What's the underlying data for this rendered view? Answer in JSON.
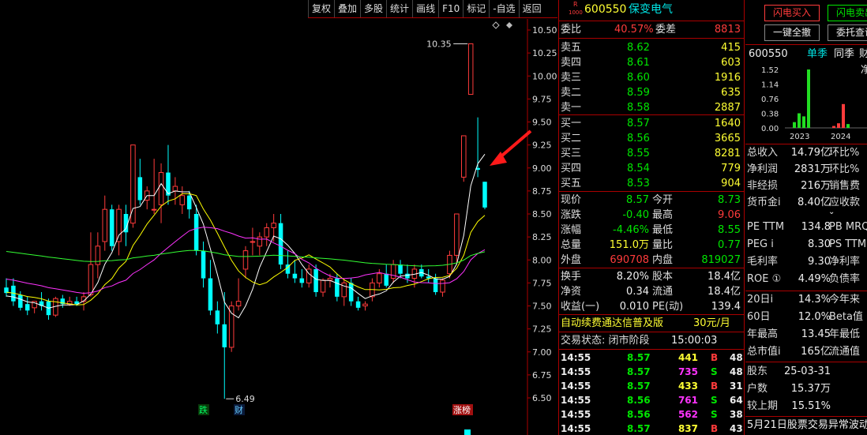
{
  "toolbar": {
    "items": [
      "复权",
      "叠加",
      "多股",
      "统计",
      "画线",
      "F10",
      "标记",
      "-自选",
      "返回"
    ]
  },
  "chart": {
    "price_axis": [
      "10.50",
      "10.25",
      "10.00",
      "9.75",
      "9.50",
      "9.25",
      "9.00",
      "8.75",
      "8.50",
      "8.25",
      "8.00",
      "7.75",
      "7.50",
      "7.25",
      "7.00",
      "6.75",
      "6.50"
    ],
    "high_label": "10.35",
    "low_label": "6.49",
    "markers": {
      "die": "跌",
      "cai": "财",
      "zhangbang": "涨榜"
    },
    "colors": {
      "up": "#ff3b3b",
      "down": "#00ffff",
      "ma5": "#ffffff",
      "ma10": "#ffff00",
      "ma20": "#ff33ff",
      "ma60": "#33ff33"
    },
    "candles": [
      {
        "o": 7.7,
        "h": 7.8,
        "l": 7.6,
        "c": 7.64
      },
      {
        "o": 7.72,
        "h": 7.8,
        "l": 7.5,
        "c": 7.55
      },
      {
        "o": 7.62,
        "h": 7.66,
        "l": 7.45,
        "c": 7.48
      },
      {
        "o": 7.52,
        "h": 7.6,
        "l": 7.4,
        "c": 7.45
      },
      {
        "o": 7.48,
        "h": 7.55,
        "l": 7.42,
        "c": 7.55
      },
      {
        "o": 7.55,
        "h": 7.65,
        "l": 7.45,
        "c": 7.5
      },
      {
        "o": 7.55,
        "h": 7.58,
        "l": 7.35,
        "c": 7.4
      },
      {
        "o": 7.4,
        "h": 7.6,
        "l": 7.38,
        "c": 7.58
      },
      {
        "o": 7.58,
        "h": 7.62,
        "l": 7.48,
        "c": 7.52
      },
      {
        "o": 7.52,
        "h": 7.6,
        "l": 7.5,
        "c": 7.55
      },
      {
        "o": 7.55,
        "h": 7.6,
        "l": 7.5,
        "c": 7.52
      },
      {
        "o": 7.55,
        "h": 7.65,
        "l": 7.45,
        "c": 7.6
      },
      {
        "o": 7.62,
        "h": 8.3,
        "l": 7.6,
        "c": 7.95
      },
      {
        "o": 7.95,
        "h": 8.3,
        "l": 7.8,
        "c": 8.15
      },
      {
        "o": 8.2,
        "h": 8.7,
        "l": 8.1,
        "c": 8.55
      },
      {
        "o": 8.55,
        "h": 8.6,
        "l": 8.1,
        "c": 8.15
      },
      {
        "o": 8.2,
        "h": 8.6,
        "l": 8.05,
        "c": 8.55
      },
      {
        "o": 8.5,
        "h": 8.6,
        "l": 8.15,
        "c": 8.3
      },
      {
        "o": 8.4,
        "h": 9.25,
        "l": 8.35,
        "c": 9.25
      },
      {
        "o": 8.9,
        "h": 9.1,
        "l": 8.6,
        "c": 8.65
      },
      {
        "o": 8.65,
        "h": 8.8,
        "l": 8.55,
        "c": 8.75
      },
      {
        "o": 8.55,
        "h": 9.1,
        "l": 8.5,
        "c": 8.55
      },
      {
        "o": 8.6,
        "h": 9.05,
        "l": 8.4,
        "c": 8.95
      },
      {
        "o": 8.95,
        "h": 9.25,
        "l": 8.6,
        "c": 8.7
      },
      {
        "o": 8.75,
        "h": 8.9,
        "l": 8.6,
        "c": 8.8
      },
      {
        "o": 8.6,
        "h": 8.8,
        "l": 8.5,
        "c": 8.7
      },
      {
        "o": 8.7,
        "h": 8.75,
        "l": 8.45,
        "c": 8.55
      },
      {
        "o": 8.5,
        "h": 8.6,
        "l": 8.05,
        "c": 8.1
      },
      {
        "o": 8.1,
        "h": 8.2,
        "l": 7.7,
        "c": 7.8
      },
      {
        "o": 7.8,
        "h": 8.0,
        "l": 7.4,
        "c": 7.45
      },
      {
        "o": 7.45,
        "h": 7.55,
        "l": 7.2,
        "c": 7.3
      },
      {
        "o": 7.3,
        "h": 7.65,
        "l": 6.49,
        "c": 7.05
      },
      {
        "o": 7.05,
        "h": 7.55,
        "l": 7.0,
        "c": 7.5
      },
      {
        "o": 7.5,
        "h": 7.8,
        "l": 7.45,
        "c": 7.55
      },
      {
        "o": 7.9,
        "h": 8.15,
        "l": 7.8,
        "c": 8.1
      },
      {
        "o": 8.2,
        "h": 8.35,
        "l": 8.05,
        "c": 8.2
      },
      {
        "o": 8.15,
        "h": 8.3,
        "l": 8.05,
        "c": 8.25
      },
      {
        "o": 8.25,
        "h": 8.4,
        "l": 8.15,
        "c": 8.35
      },
      {
        "o": 8.35,
        "h": 8.5,
        "l": 8.2,
        "c": 8.4
      },
      {
        "o": 8.4,
        "h": 8.5,
        "l": 7.9,
        "c": 7.95
      },
      {
        "o": 7.95,
        "h": 8.1,
        "l": 7.8,
        "c": 7.85
      },
      {
        "o": 7.85,
        "h": 8.0,
        "l": 7.75,
        "c": 7.8
      },
      {
        "o": 7.8,
        "h": 7.9,
        "l": 7.7,
        "c": 7.75
      },
      {
        "o": 7.75,
        "h": 7.95,
        "l": 7.7,
        "c": 7.9
      },
      {
        "o": 7.9,
        "h": 7.95,
        "l": 7.6,
        "c": 7.65
      },
      {
        "o": 7.65,
        "h": 7.8,
        "l": 7.6,
        "c": 7.78
      },
      {
        "o": 7.78,
        "h": 7.85,
        "l": 7.7,
        "c": 7.8
      },
      {
        "o": 7.8,
        "h": 7.85,
        "l": 7.55,
        "c": 7.6
      },
      {
        "o": 7.6,
        "h": 7.8,
        "l": 7.5,
        "c": 7.75
      },
      {
        "o": 7.75,
        "h": 7.8,
        "l": 7.5,
        "c": 7.55
      },
      {
        "o": 7.55,
        "h": 7.6,
        "l": 7.45,
        "c": 7.48
      },
      {
        "o": 7.5,
        "h": 7.55,
        "l": 7.45,
        "c": 7.52
      },
      {
        "o": 7.6,
        "h": 7.8,
        "l": 7.55,
        "c": 7.75
      },
      {
        "o": 7.75,
        "h": 7.9,
        "l": 7.7,
        "c": 7.85
      },
      {
        "o": 7.85,
        "h": 7.95,
        "l": 7.7,
        "c": 7.72
      },
      {
        "o": 7.8,
        "h": 8.0,
        "l": 7.75,
        "c": 7.95
      },
      {
        "o": 7.95,
        "h": 8.0,
        "l": 7.8,
        "c": 7.85
      },
      {
        "o": 7.85,
        "h": 7.95,
        "l": 7.75,
        "c": 7.8
      },
      {
        "o": 7.8,
        "h": 7.95,
        "l": 7.7,
        "c": 7.9
      },
      {
        "o": 7.9,
        "h": 7.95,
        "l": 7.8,
        "c": 7.82
      },
      {
        "o": 7.82,
        "h": 7.9,
        "l": 7.75,
        "c": 7.8
      },
      {
        "o": 7.8,
        "h": 7.85,
        "l": 7.62,
        "c": 7.65
      },
      {
        "o": 7.65,
        "h": 7.8,
        "l": 7.6,
        "c": 7.78
      },
      {
        "o": 7.85,
        "h": 8.1,
        "l": 7.8,
        "c": 8.05
      },
      {
        "o": 8.05,
        "h": 8.5,
        "l": 7.95,
        "c": 8.5
      },
      {
        "o": 8.9,
        "h": 9.35,
        "l": 8.85,
        "c": 9.35
      },
      {
        "o": 9.8,
        "h": 10.35,
        "l": 9.8,
        "c": 10.35
      },
      {
        "o": 9.0,
        "h": 9.55,
        "l": 8.9,
        "c": 8.98
      },
      {
        "o": 8.85,
        "h": 8.85,
        "l": 8.55,
        "c": 8.57
      }
    ]
  },
  "quote": {
    "code": "600550",
    "name": "保变电气",
    "tag_r": "R",
    "tag_num": "1000",
    "weibi_label": "委比",
    "weibi": "40.57%",
    "weicha_label": "委差",
    "weicha": "8813",
    "asks": [
      {
        "label": "卖五",
        "price": "8.62",
        "vol": "415"
      },
      {
        "label": "卖四",
        "price": "8.61",
        "vol": "603"
      },
      {
        "label": "卖三",
        "price": "8.60",
        "vol": "1916"
      },
      {
        "label": "卖二",
        "price": "8.59",
        "vol": "635"
      },
      {
        "label": "卖一",
        "price": "8.58",
        "vol": "2887"
      }
    ],
    "bids": [
      {
        "label": "买一",
        "price": "8.57",
        "vol": "1640"
      },
      {
        "label": "买二",
        "price": "8.56",
        "vol": "3665"
      },
      {
        "label": "买三",
        "price": "8.55",
        "vol": "8281"
      },
      {
        "label": "买四",
        "price": "8.54",
        "vol": "779"
      },
      {
        "label": "买五",
        "price": "8.53",
        "vol": "904"
      }
    ],
    "stats": [
      {
        "l1": "现价",
        "v1": "8.57",
        "c1": "green",
        "l2": "今开",
        "v2": "8.73",
        "c2": "green"
      },
      {
        "l1": "涨跌",
        "v1": "-0.40",
        "c1": "green",
        "l2": "最高",
        "v2": "9.06",
        "c2": "red"
      },
      {
        "l1": "涨幅",
        "v1": "-4.46%",
        "c1": "green",
        "l2": "最低",
        "v2": "8.55",
        "c2": "green"
      },
      {
        "l1": "总量",
        "v1": "151.0万",
        "c1": "yellow",
        "l2": "量比",
        "v2": "0.77",
        "c2": "green"
      },
      {
        "l1": "外盘",
        "v1": "690708",
        "c1": "red",
        "l2": "内盘",
        "v2": "819027",
        "c2": "green"
      }
    ],
    "fund": [
      {
        "l1": "换手",
        "v1": "8.20%",
        "l2": "股本",
        "v2": "18.4亿"
      },
      {
        "l1": "净资",
        "v1": "0.34",
        "l2": "流通",
        "v2": "18.4亿"
      },
      {
        "l1": "收益(一)",
        "v1": "0.010",
        "l2": "PE(动)",
        "v2": "139.4"
      }
    ],
    "ad_text": "自动续费通达信普及版",
    "ad_price": "30元/月",
    "status_label": "交易状态: 闭市阶段",
    "status_time": "15:00:03",
    "ticks": [
      {
        "t": "14:55",
        "p": "8.57",
        "v": "441",
        "s": "B",
        "n": "48"
      },
      {
        "t": "14:55",
        "p": "8.57",
        "v": "735",
        "s": "S",
        "n": "48"
      },
      {
        "t": "14:55",
        "p": "8.57",
        "v": "433",
        "s": "B",
        "n": "31"
      },
      {
        "t": "14:55",
        "p": "8.56",
        "v": "761",
        "s": "S",
        "n": "64"
      },
      {
        "t": "14:55",
        "p": "8.56",
        "v": "562",
        "s": "S",
        "n": "38"
      },
      {
        "t": "14:55",
        "p": "8.57",
        "v": "837",
        "s": "B",
        "n": "43"
      }
    ]
  },
  "side": {
    "btn_flash_buy": "闪电买入",
    "btn_flash_sell": "闪电卖出",
    "btn_cancel_all": "一键全撤",
    "btn_entrust": "委托查询",
    "code": "600550",
    "tab_single": "单季",
    "tab_yoy": "同季",
    "tab_fin": "财务",
    "mini_label": "净",
    "mini_axis": [
      "1.52",
      "1.14",
      "0.76",
      "0.38",
      "0.00"
    ],
    "mini_years": [
      "2023",
      "2024"
    ],
    "mini_2023": [
      0.15,
      0.38,
      0.3,
      1.52
    ],
    "mini_2024": [
      0.05,
      0.12,
      0.62,
      0.1
    ],
    "rows1": [
      {
        "l": "总收入",
        "v": "14.79亿",
        "r": "环比%"
      },
      {
        "l": "净利润",
        "v": "2831万",
        "r": "环比%"
      },
      {
        "l": "非经损",
        "v": "216万",
        "r": "销售费"
      },
      {
        "l": "货币金i",
        "v": "8.40亿",
        "r": "应收款"
      }
    ],
    "rows2": [
      {
        "l": "PE TTM",
        "v": "134.8",
        "r": "PB MRQ"
      },
      {
        "l": "PEG i",
        "v": "8.30",
        "r": "PS TTM"
      },
      {
        "l": "毛利率",
        "v": "9.30",
        "r": "净利率"
      },
      {
        "l": "ROE ①",
        "v": "4.49%",
        "r": "负债率"
      }
    ],
    "rows3": [
      {
        "l": "20日i",
        "v": "14.3%",
        "r": "今年来"
      },
      {
        "l": "60日",
        "v": "12.0%",
        "r": "Beta值"
      },
      {
        "l": "年最高",
        "v": "13.45",
        "r": "年最低"
      },
      {
        "l": "总市值i",
        "v": "165亿",
        "r": "流通值"
      }
    ],
    "rows4": [
      {
        "l": "股东",
        "v": "25-03-31"
      },
      {
        "l": "户数",
        "v": "15.37万"
      },
      {
        "l": "较上期",
        "v": "15.51%"
      }
    ],
    "news": "5月21日股票交易异常波动"
  }
}
